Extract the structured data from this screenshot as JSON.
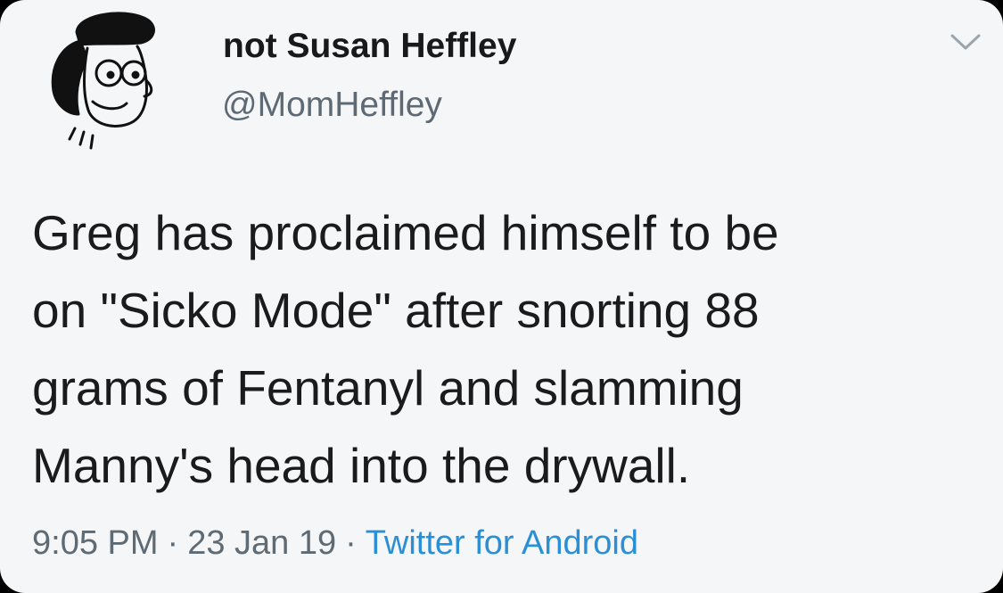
{
  "tweet": {
    "author": {
      "display_name": "not Susan Heffley",
      "handle": "@MomHeffley",
      "avatar_icon": "cartoon-mom-avatar-icon"
    },
    "menu_icon": "chevron-down-icon",
    "text_lines": [
      "Greg has proclaimed himself to be",
      "on \"Sicko Mode\" after snorting 88",
      "grams of Fentanyl and slamming",
      "Manny's head into the drywall."
    ],
    "time": "9:05 PM",
    "date": "23 Jan 19",
    "separator": "·",
    "source": "Twitter for Android"
  },
  "colors": {
    "background": "#f5f6f7",
    "text": "#1a1b1c",
    "secondary": "#5e6a74",
    "link": "#2b8fd6"
  }
}
